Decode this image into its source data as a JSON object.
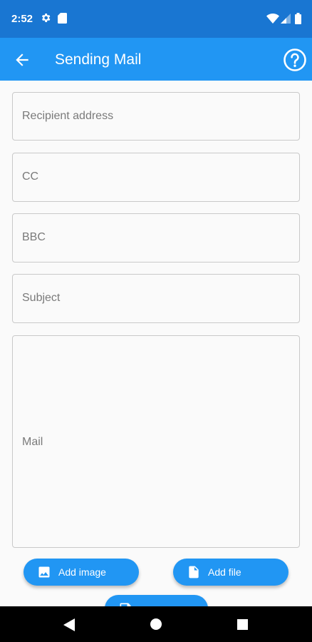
{
  "status_bar": {
    "time": "2:52",
    "icons": [
      "settings-icon",
      "sd-card-icon",
      "wifi-icon",
      "cell-signal-icon",
      "battery-icon"
    ]
  },
  "app_bar": {
    "title": "Sending Mail",
    "back_icon": "arrow-back-icon",
    "help_icon": "help-circle-icon",
    "color": "#2196f3",
    "status_color": "#1976d2"
  },
  "form": {
    "recipient": {
      "placeholder": "Recipient address",
      "value": ""
    },
    "cc": {
      "placeholder": "CC",
      "value": ""
    },
    "bbc": {
      "placeholder": "BBC",
      "value": ""
    },
    "subject": {
      "placeholder": "Subject",
      "value": ""
    },
    "mail": {
      "placeholder": "Mail",
      "value": ""
    }
  },
  "actions": {
    "add_image": {
      "label": "Add image",
      "icon": "image-icon"
    },
    "add_file": {
      "label": "Add file",
      "icon": "file-icon"
    },
    "send": {
      "label": "",
      "icon": "send-icon"
    }
  },
  "nav_bar": {
    "icons": [
      "nav-back-icon",
      "nav-home-icon",
      "nav-recents-icon"
    ]
  }
}
